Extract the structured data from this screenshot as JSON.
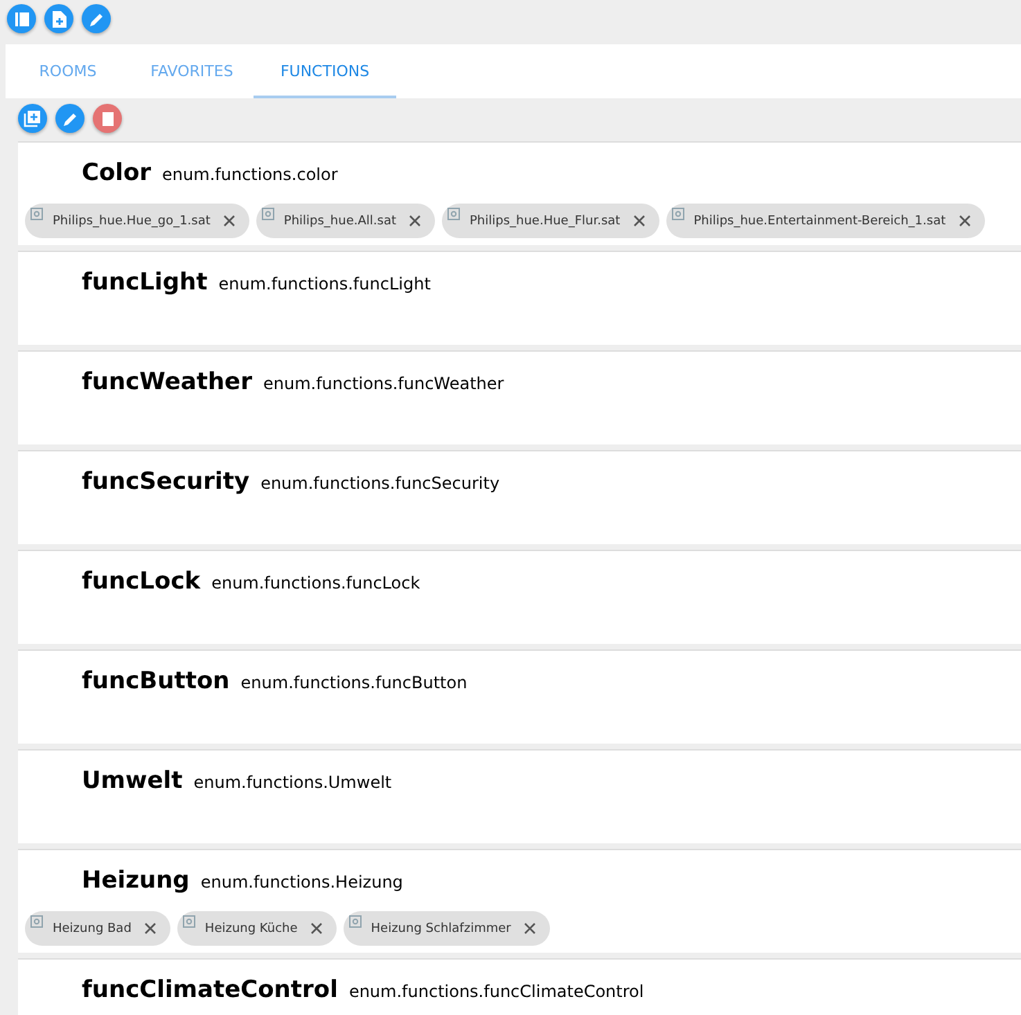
{
  "tabs": [
    {
      "label": "ROOMS",
      "selected": false
    },
    {
      "label": "FAVORITES",
      "selected": false
    },
    {
      "label": "FUNCTIONS",
      "selected": true
    }
  ],
  "enums": [
    {
      "name": "Color",
      "id": "enum.functions.color",
      "members": [
        {
          "label": "Philips_hue.Hue_go_1.sat"
        },
        {
          "label": "Philips_hue.All.sat"
        },
        {
          "label": "Philips_hue.Hue_Flur.sat"
        },
        {
          "label": "Philips_hue.Entertainment-Bereich_1.sat"
        }
      ]
    },
    {
      "name": "funcLight",
      "id": "enum.functions.funcLight"
    },
    {
      "name": "funcWeather",
      "id": "enum.functions.funcWeather"
    },
    {
      "name": "funcSecurity",
      "id": "enum.functions.funcSecurity"
    },
    {
      "name": "funcLock",
      "id": "enum.functions.funcLock"
    },
    {
      "name": "funcButton",
      "id": "enum.functions.funcButton"
    },
    {
      "name": "Umwelt",
      "id": "enum.functions.Umwelt"
    },
    {
      "name": "Heizung",
      "id": "enum.functions.Heizung",
      "members": [
        {
          "label": "Heizung Bad"
        },
        {
          "label": "Heizung Küche"
        },
        {
          "label": "Heizung Schlafzimmer"
        }
      ]
    },
    {
      "name": "funcClimateControl",
      "id": "enum.functions.funcClimateControl"
    }
  ]
}
